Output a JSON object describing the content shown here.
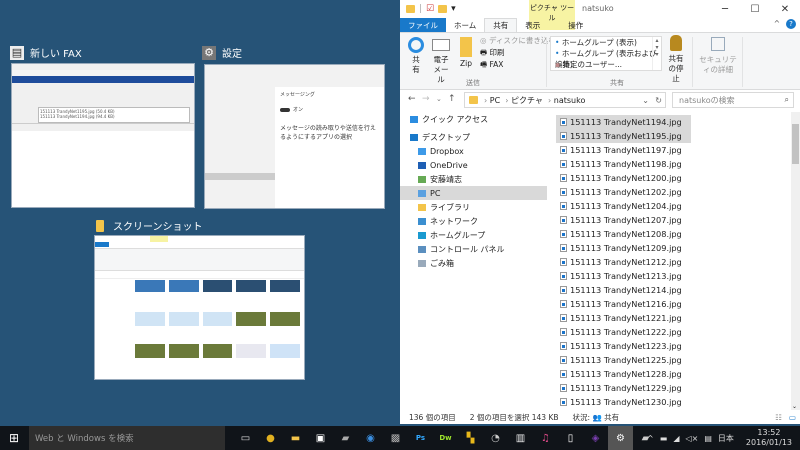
{
  "thumbnails": [
    {
      "title": "新しい FAX",
      "icon": "fax-icon",
      "attachments": [
        "151113 TrandyNet1195.jpg (50.4 KB)",
        "151113 TrandyNet1194.jpg (94.4 KB)"
      ]
    },
    {
      "title": "設定",
      "icon": "gear-icon",
      "heading": "メッセージング",
      "subheading": "メッセージの読み取りや送信を行えるようにするアプリの選択",
      "toggle": "オン"
    },
    {
      "title": "スクリーンショット",
      "icon": "folder-icon"
    }
  ],
  "explorer": {
    "title": "natsuko",
    "context_tab": "ピクチャ ツール",
    "tabs": [
      "ファイル",
      "ホーム",
      "共有",
      "表示",
      "操作"
    ],
    "active_tab": "共有",
    "ribbon": {
      "share": "共有",
      "email": "電子メール",
      "zip": "Zip",
      "burn": "ディスクに書き込む",
      "print": "印刷",
      "fax": "FAX",
      "send_group": "送信",
      "share_with": [
        "ホームグループ (表示)",
        "ホームグループ (表示および編集)",
        "特定のユーザー..."
      ],
      "share_group": "共有",
      "stop_sharing": "共有の停止",
      "security": "セキュリティの詳細"
    },
    "address": [
      "PC",
      "ピクチャ",
      "natsuko"
    ],
    "search_placeholder": "natsukoの検索",
    "nav": [
      "クイック アクセス",
      "デスクトップ",
      "Dropbox",
      "OneDrive",
      "安藤靖志",
      "PC",
      "ライブラリ",
      "ネットワーク",
      "ホームグループ",
      "コントロール パネル",
      "ごみ箱"
    ],
    "nav_selected": "PC",
    "files": [
      "151113 TrandyNet1194.jpg",
      "151113 TrandyNet1195.jpg",
      "151113 TrandyNet1197.jpg",
      "151113 TrandyNet1198.jpg",
      "151113 TrandyNet1200.jpg",
      "151113 TrandyNet1202.jpg",
      "151113 TrandyNet1204.jpg",
      "151113 TrandyNet1207.jpg",
      "151113 TrandyNet1208.jpg",
      "151113 TrandyNet1209.jpg",
      "151113 TrandyNet1212.jpg",
      "151113 TrandyNet1213.jpg",
      "151113 TrandyNet1214.jpg",
      "151113 TrandyNet1216.jpg",
      "151113 TrandyNet1221.jpg",
      "151113 TrandyNet1222.jpg",
      "151113 TrandyNet1223.jpg",
      "151113 TrandyNet1225.jpg",
      "151113 TrandyNet1228.jpg",
      "151113 TrandyNet1229.jpg",
      "151113 TrandyNet1230.jpg"
    ],
    "selected_files": [
      0,
      1
    ],
    "status": {
      "count": "136 個の項目",
      "selection": "2 個の項目を選択  143 KB",
      "state": "状況:",
      "state_value": "共有"
    }
  },
  "taskbar": {
    "search_placeholder": "Web と Windows を検索",
    "apps": [
      "task-view",
      "chrome",
      "file-explorer",
      "store",
      "scanner",
      "thunderbird",
      "media",
      "photoshop",
      "dreamweaver",
      "filezilla",
      "utility",
      "ebook",
      "itunes",
      "notepad",
      "onenote",
      "settings",
      "fax"
    ],
    "ime": "日本",
    "time": "13:52",
    "date": "2016/01/13"
  },
  "colors": {
    "desktop": "#265377",
    "accent": "#1979ca",
    "taskbar": "#101419"
  }
}
